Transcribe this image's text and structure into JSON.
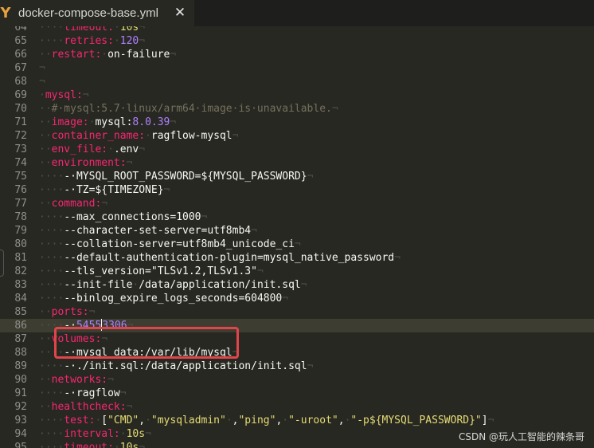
{
  "tab": {
    "icon": "yaml-file-icon",
    "title": "docker-compose-base.yml",
    "close_glyph": "✕"
  },
  "watermark": "CSDN @玩人工智能的辣条哥",
  "colors": {
    "keyword": "#f92672",
    "string": "#e6db74",
    "number": "#ae81ff",
    "comment": "#75715e",
    "text": "#f8f8f2",
    "highlight_box": "#e0454a"
  },
  "lines": [
    {
      "n": "64",
      "segs": [
        [
          "ws",
          "····"
        ],
        [
          "key",
          "timeout:"
        ],
        [
          "ws",
          "·"
        ],
        [
          "str",
          "10s"
        ],
        [
          "ws",
          "¬"
        ]
      ]
    },
    {
      "n": "65",
      "segs": [
        [
          "ws",
          "····"
        ],
        [
          "key",
          "retries:"
        ],
        [
          "ws",
          "·"
        ],
        [
          "num",
          "120"
        ],
        [
          "ws",
          "¬"
        ]
      ]
    },
    {
      "n": "66",
      "segs": [
        [
          "ws",
          "··"
        ],
        [
          "key",
          "restart:"
        ],
        [
          "ws",
          "·"
        ],
        [
          "txt",
          "on-failure"
        ],
        [
          "ws",
          "¬"
        ]
      ]
    },
    {
      "n": "67",
      "segs": [
        [
          "ws",
          "¬"
        ]
      ]
    },
    {
      "n": "68",
      "segs": [
        [
          "ws",
          "¬"
        ]
      ]
    },
    {
      "n": "69",
      "segs": [
        [
          "ws",
          "·"
        ],
        [
          "key",
          "mysql:"
        ],
        [
          "ws",
          "¬"
        ]
      ]
    },
    {
      "n": "70",
      "segs": [
        [
          "ws",
          "··"
        ],
        [
          "cmt",
          "#·mysql:5.7·linux/arm64·image·is·unavailable."
        ],
        [
          "ws",
          "¬"
        ]
      ]
    },
    {
      "n": "71",
      "segs": [
        [
          "ws",
          "··"
        ],
        [
          "key",
          "image:"
        ],
        [
          "ws",
          "·"
        ],
        [
          "txt",
          "mysql:"
        ],
        [
          "num",
          "8.0.39"
        ],
        [
          "ws",
          "¬"
        ]
      ]
    },
    {
      "n": "72",
      "segs": [
        [
          "ws",
          "··"
        ],
        [
          "key",
          "container_name:"
        ],
        [
          "ws",
          "·"
        ],
        [
          "txt",
          "ragflow-mysql"
        ],
        [
          "ws",
          "¬"
        ]
      ]
    },
    {
      "n": "73",
      "segs": [
        [
          "ws",
          "··"
        ],
        [
          "key",
          "env_file:"
        ],
        [
          "ws",
          "·"
        ],
        [
          "txt",
          ".env"
        ],
        [
          "ws",
          "¬"
        ]
      ]
    },
    {
      "n": "74",
      "segs": [
        [
          "ws",
          "··"
        ],
        [
          "key",
          "environment:"
        ],
        [
          "ws",
          "¬"
        ]
      ]
    },
    {
      "n": "75",
      "segs": [
        [
          "ws",
          "····"
        ],
        [
          "txt",
          "-·MYSQL_ROOT_PASSWORD=${MYSQL_PASSWORD}"
        ],
        [
          "ws",
          "¬"
        ]
      ]
    },
    {
      "n": "76",
      "segs": [
        [
          "ws",
          "····"
        ],
        [
          "txt",
          "-·TZ=${TIMEZONE}"
        ],
        [
          "ws",
          "¬"
        ]
      ]
    },
    {
      "n": "77",
      "segs": [
        [
          "ws",
          "··"
        ],
        [
          "key",
          "command:"
        ],
        [
          "ws",
          "¬"
        ]
      ]
    },
    {
      "n": "78",
      "segs": [
        [
          "ws",
          "····"
        ],
        [
          "txt",
          "--max_connections=1000"
        ],
        [
          "ws",
          "¬"
        ]
      ]
    },
    {
      "n": "79",
      "segs": [
        [
          "ws",
          "····"
        ],
        [
          "txt",
          "--character-set-server=utf8mb4"
        ],
        [
          "ws",
          "¬"
        ]
      ]
    },
    {
      "n": "80",
      "segs": [
        [
          "ws",
          "····"
        ],
        [
          "txt",
          "--collation-server=utf8mb4_unicode_ci"
        ],
        [
          "ws",
          "¬"
        ]
      ]
    },
    {
      "n": "81",
      "segs": [
        [
          "ws",
          "····"
        ],
        [
          "txt",
          "--default-authentication-plugin=mysql_native_password"
        ],
        [
          "ws",
          "¬"
        ]
      ]
    },
    {
      "n": "82",
      "segs": [
        [
          "ws",
          "····"
        ],
        [
          "txt",
          "--tls_version=\"TLSv1.2,TLSv1.3\""
        ],
        [
          "ws",
          "¬"
        ]
      ]
    },
    {
      "n": "83",
      "segs": [
        [
          "ws",
          "····"
        ],
        [
          "txt",
          "--init-file"
        ],
        [
          "ws",
          "·"
        ],
        [
          "txt",
          "/data/application/init.sql"
        ],
        [
          "ws",
          "¬"
        ]
      ]
    },
    {
      "n": "84",
      "segs": [
        [
          "ws",
          "····"
        ],
        [
          "txt",
          "--binlog_expire_logs_seconds=604800"
        ],
        [
          "ws",
          "¬"
        ]
      ]
    },
    {
      "n": "85",
      "segs": [
        [
          "ws",
          "··"
        ],
        [
          "key",
          "ports:"
        ],
        [
          "ws",
          "¬"
        ]
      ]
    },
    {
      "n": "86",
      "active": true,
      "segs": [
        [
          "ws",
          "····"
        ],
        [
          "txt",
          "-·"
        ],
        [
          "num",
          "5455"
        ],
        [
          "cursor",
          ""
        ],
        [
          "num",
          "3306"
        ],
        [
          "ws",
          "¬"
        ]
      ]
    },
    {
      "n": "87",
      "segs": [
        [
          "ws",
          "··"
        ],
        [
          "key",
          "volumes:"
        ],
        [
          "ws",
          "¬"
        ]
      ]
    },
    {
      "n": "88",
      "segs": [
        [
          "ws",
          "····"
        ],
        [
          "txt",
          "-·mysql_data:/var/lib/mysql"
        ],
        [
          "ws",
          "¬"
        ]
      ]
    },
    {
      "n": "89",
      "segs": [
        [
          "ws",
          "····"
        ],
        [
          "txt",
          "-·./init.sql:/data/application/init.sql"
        ],
        [
          "ws",
          "¬"
        ]
      ]
    },
    {
      "n": "90",
      "segs": [
        [
          "ws",
          "··"
        ],
        [
          "key",
          "networks:"
        ],
        [
          "ws",
          "¬"
        ]
      ]
    },
    {
      "n": "91",
      "segs": [
        [
          "ws",
          "····"
        ],
        [
          "txt",
          "-·ragflow"
        ],
        [
          "ws",
          "¬"
        ]
      ]
    },
    {
      "n": "92",
      "segs": [
        [
          "ws",
          "··"
        ],
        [
          "key",
          "healthcheck:"
        ],
        [
          "ws",
          "¬"
        ]
      ]
    },
    {
      "n": "93",
      "segs": [
        [
          "ws",
          "····"
        ],
        [
          "key",
          "test:"
        ],
        [
          "ws",
          "·"
        ],
        [
          "txt",
          "["
        ],
        [
          "str",
          "\"CMD\""
        ],
        [
          "txt",
          ","
        ],
        [
          "ws",
          "·"
        ],
        [
          "str",
          "\"mysqladmin\""
        ],
        [
          "ws",
          "·"
        ],
        [
          "txt",
          ","
        ],
        [
          "str",
          "\"ping\""
        ],
        [
          "txt",
          ","
        ],
        [
          "ws",
          "·"
        ],
        [
          "str",
          "\"-uroot\""
        ],
        [
          "txt",
          ","
        ],
        [
          "ws",
          "·"
        ],
        [
          "str",
          "\"-p${MYSQL_PASSWORD}\""
        ],
        [
          "txt",
          "]"
        ],
        [
          "ws",
          "¬"
        ]
      ]
    },
    {
      "n": "94",
      "segs": [
        [
          "ws",
          "····"
        ],
        [
          "key",
          "interval:"
        ],
        [
          "ws",
          "·"
        ],
        [
          "str",
          "10s"
        ],
        [
          "ws",
          "¬"
        ]
      ]
    },
    {
      "n": "95",
      "segs": [
        [
          "ws",
          "····"
        ],
        [
          "key",
          "timeout:"
        ],
        [
          "ws",
          "·"
        ],
        [
          "str",
          "10s"
        ],
        [
          "ws",
          "¬"
        ]
      ]
    }
  ]
}
